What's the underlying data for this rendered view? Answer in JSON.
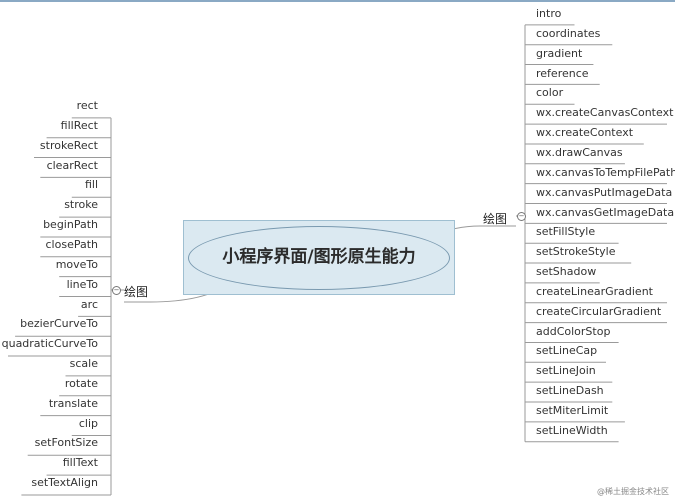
{
  "center": {
    "title": "小程序界面/图形原生能力"
  },
  "left_branch": {
    "label": "绘图",
    "items": [
      "rect",
      "fillRect",
      "strokeRect",
      "clearRect",
      "fill",
      "stroke",
      "beginPath",
      "closePath",
      "moveTo",
      "lineTo",
      "arc",
      "bezierCurveTo",
      "quadraticCurveTo",
      "scale",
      "rotate",
      "translate",
      "clip",
      "setFontSize",
      "fillText",
      "setTextAlign"
    ]
  },
  "right_branch": {
    "label": "绘图",
    "items": [
      "intro",
      "coordinates",
      "gradient",
      "reference",
      "color",
      "wx.createCanvasContext",
      "wx.createContext",
      "wx.drawCanvas",
      "wx.canvasToTempFilePath",
      "wx.canvasPutImageData",
      "wx.canvasGetImageData",
      "setFillStyle",
      "setStrokeStyle",
      "setShadow",
      "createLinearGradient",
      "createCircularGradient",
      "addColorStop",
      "setLineCap",
      "setLineJoin",
      "setLineDash",
      "setMiterLimit",
      "setLineWidth"
    ]
  },
  "watermark": "@稀土掘金技术社区",
  "colors": {
    "line": "#9a9a9a",
    "center_fill": "#dbe9f1",
    "center_border": "#7a9ab0"
  }
}
